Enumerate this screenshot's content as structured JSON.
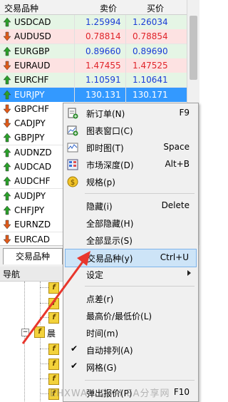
{
  "market_watch": {
    "headers": {
      "symbol": "交易品种",
      "bid": "卖价",
      "ask": "买价"
    },
    "rows": [
      {
        "symbol": "USDCAD",
        "bid": "1.25994",
        "ask": "1.26034",
        "dir": "up",
        "bg": "#e5f5e5",
        "color": "#1a3cd6"
      },
      {
        "symbol": "AUDUSD",
        "bid": "0.78814",
        "ask": "0.78854",
        "dir": "down",
        "bg": "#fde2e2",
        "color": "#e0242a"
      },
      {
        "symbol": "EURGBP",
        "bid": "0.89660",
        "ask": "0.89690",
        "dir": "up",
        "bg": "#e5f5e5",
        "color": "#1a3cd6"
      },
      {
        "symbol": "EURAUD",
        "bid": "1.47455",
        "ask": "1.47525",
        "dir": "down",
        "bg": "#fde2e2",
        "color": "#e0242a"
      },
      {
        "symbol": "EURCHF",
        "bid": "1.10591",
        "ask": "1.10641",
        "dir": "up",
        "bg": "#e5f5e5",
        "color": "#1a3cd6"
      },
      {
        "symbol": "EURJPY",
        "bid": "130.131",
        "ask": "130.171",
        "dir": "up",
        "bg": "#3399ff",
        "color": "#ffffff",
        "selected": true
      },
      {
        "symbol": "GBPCHF",
        "bid": "",
        "ask": "",
        "dir": "down",
        "bg": "#ffffff",
        "color": "#000000"
      },
      {
        "symbol": "CADJPY",
        "bid": "",
        "ask": "",
        "dir": "down",
        "bg": "#ffffff",
        "color": "#000000"
      },
      {
        "symbol": "GBPJPY",
        "bid": "",
        "ask": "",
        "dir": "up",
        "bg": "#ffffff",
        "color": "#000000"
      },
      {
        "symbol": "AUDNZD",
        "bid": "",
        "ask": "",
        "dir": "up",
        "bg": "#ffffff",
        "color": "#000000"
      },
      {
        "symbol": "AUDCAD",
        "bid": "",
        "ask": "",
        "dir": "up",
        "bg": "#ffffff",
        "color": "#000000"
      },
      {
        "symbol": "AUDCHF",
        "bid": "",
        "ask": "",
        "dir": "up",
        "bg": "#ffffff",
        "color": "#000000"
      },
      {
        "symbol": "AUDJPY",
        "bid": "",
        "ask": "",
        "dir": "up",
        "bg": "#ffffff",
        "color": "#000000"
      },
      {
        "symbol": "CHFJPY",
        "bid": "",
        "ask": "",
        "dir": "up",
        "bg": "#ffffff",
        "color": "#000000"
      },
      {
        "symbol": "EURNZD",
        "bid": "",
        "ask": "",
        "dir": "down",
        "bg": "#ffffff",
        "color": "#000000"
      },
      {
        "symbol": "EURCAD",
        "bid": "",
        "ask": "",
        "dir": "down",
        "bg": "#ffffff",
        "color": "#000000"
      }
    ]
  },
  "tabs": {
    "symbols_tab": "交易品种"
  },
  "navigator": {
    "title": "导航",
    "folder_label": "晨"
  },
  "context_menu": {
    "items": [
      {
        "label": "新订单(N)",
        "shortcut": "F9",
        "icon": "new-order-icon"
      },
      {
        "label": "图表窗口(C)",
        "shortcut": "",
        "icon": "chart-window-icon"
      },
      {
        "label": "即时图(T)",
        "shortcut": "Space",
        "icon": "tick-chart-icon"
      },
      {
        "label": "市场深度(D)",
        "shortcut": "Alt+B",
        "icon": "depth-of-market-icon"
      },
      {
        "label": "规格(p)",
        "shortcut": "",
        "icon": "specification-icon"
      },
      {
        "label": "隐藏(i)",
        "shortcut": "Delete",
        "icon": ""
      },
      {
        "label": "全部隐藏(H)",
        "shortcut": "",
        "icon": ""
      },
      {
        "label": "全部显示(S)",
        "shortcut": "",
        "icon": ""
      },
      {
        "label": "交易品种(y)",
        "shortcut": "Ctrl+U",
        "icon": "",
        "highlight": true
      },
      {
        "label": "设定",
        "shortcut": "",
        "icon": "",
        "submenu": true
      },
      {
        "label": "点差(r)",
        "shortcut": "",
        "icon": ""
      },
      {
        "label": "最高价/最低价(L)",
        "shortcut": "",
        "icon": ""
      },
      {
        "label": "时间(m)",
        "shortcut": "",
        "icon": ""
      },
      {
        "label": "自动排列(A)",
        "shortcut": "",
        "icon": "",
        "checked": true
      },
      {
        "label": "网格(G)",
        "shortcut": "",
        "icon": "",
        "checked": true
      },
      {
        "label": "弹出报价(P)",
        "shortcut": "F10",
        "icon": ""
      }
    ]
  },
  "watermark": "EHXWAN.COM EA分享网",
  "colors": {
    "up_arrow": "#2aa02a",
    "down_arrow": "#e05a1a",
    "annotation_arrow": "#e8362c"
  }
}
